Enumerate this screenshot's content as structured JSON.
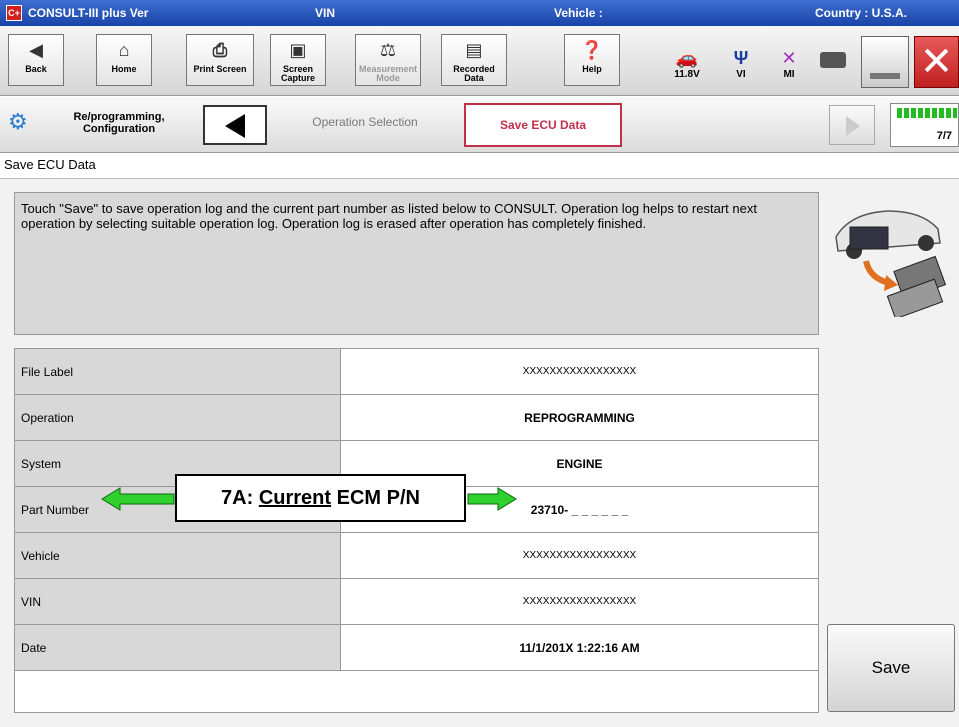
{
  "window": {
    "title": "CONSULT-III plus  Ver",
    "vin_label": "VIN",
    "vehicle_label": "Vehicle :",
    "country_label": "Country : U.S.A.",
    "logo_text": "C+"
  },
  "toolbar": {
    "back": "Back",
    "home": "Home",
    "print": "Print Screen",
    "capture": "Screen\nCapture",
    "measurement": "Measurement\nMode",
    "recorded": "Recorded\nData",
    "help": "Help",
    "voltage": "11.8V",
    "vi_label": "VI",
    "mi_label": "MI"
  },
  "breadcrumb": {
    "section": "Re/programming,\nConfiguration",
    "step1": "Operation Selection",
    "step2": "Save ECU Data",
    "progress": "7/7"
  },
  "page_title": "Save ECU Data",
  "message": "Touch \"Save\" to save operation log and the current part number as listed below to CONSULT. Operation log helps to restart next operation by selecting suitable operation log. Operation log is erased after operation has completely finished.",
  "rows": [
    {
      "label": "File Label",
      "value": "XXXXXXXXXXXXXXXXX"
    },
    {
      "label": "Operation",
      "value": "REPROGRAMMING"
    },
    {
      "label": "System",
      "value": "ENGINE"
    },
    {
      "label": "Part Number",
      "value": "23710- _ _ _ _ _ _"
    },
    {
      "label": "Vehicle",
      "value": "XXXXXXXXXXXXXXXXX"
    },
    {
      "label": "VIN",
      "value": "XXXXXXXXXXXXXXXXX"
    },
    {
      "label": "Date",
      "value": "11/1/201X 1:22:16 AM"
    }
  ],
  "save_button": "Save",
  "callout": {
    "prefix": "7A: ",
    "underlined": "Current",
    "suffix": " ECM P/N"
  },
  "colors": {
    "titlebar": "#1a43a8",
    "arrow": "#2fd12f",
    "progress": "#22bb22",
    "active_tab_border": "#c0304a"
  }
}
